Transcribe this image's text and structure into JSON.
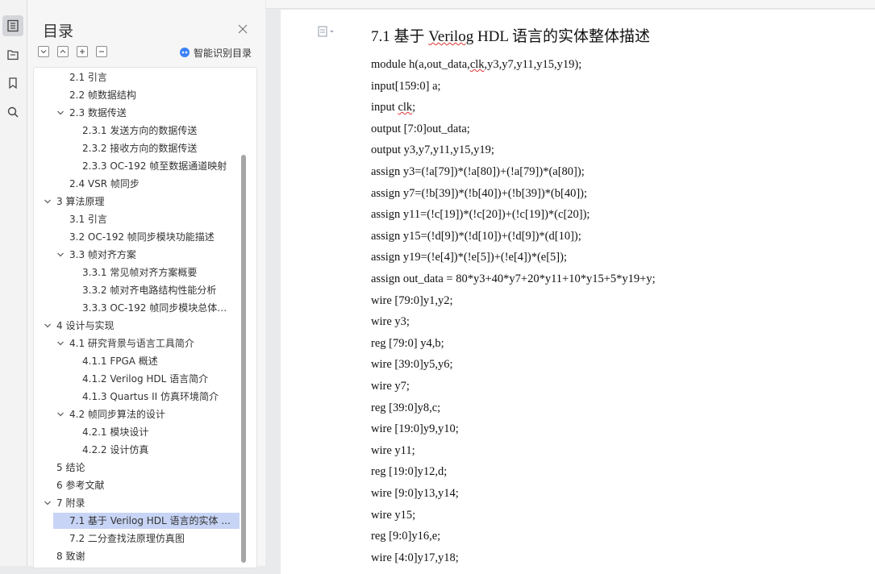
{
  "rail": {
    "icons": [
      "outline-icon",
      "folder-tree-icon",
      "bookmark-icon",
      "search-icon"
    ]
  },
  "panel": {
    "title": "目录",
    "smart_label": "智能识别目录",
    "toolbar": [
      "collapse-all",
      "expand-all",
      "add",
      "remove"
    ],
    "toc": [
      {
        "label": "2.1  引言",
        "level": 2,
        "expandable": false
      },
      {
        "label": "2.2  帧数据结构",
        "level": 2,
        "expandable": false
      },
      {
        "label": "2.3 数据传送",
        "level": 2,
        "expandable": true
      },
      {
        "label": "2.3.1  发送方向的数据传送",
        "level": 3,
        "expandable": false
      },
      {
        "label": "2.3.2  接收方向的数据传送",
        "level": 3,
        "expandable": false
      },
      {
        "label": "2.3.3 OC-192 帧至数据通道映射",
        "level": 3,
        "expandable": false
      },
      {
        "label": "2.4 VSR 帧同步",
        "level": 2,
        "expandable": false
      },
      {
        "label": "3  算法原理",
        "level": 1,
        "expandable": true
      },
      {
        "label": "3.1  引言",
        "level": 2,
        "expandable": false
      },
      {
        "label": "3.2 OC-192 帧同步模块功能描述",
        "level": 2,
        "expandable": false
      },
      {
        "label": "3.3  帧对齐方案",
        "level": 2,
        "expandable": true
      },
      {
        "label": "3.3.1  常见帧对齐方案概要",
        "level": 3,
        "expandable": false
      },
      {
        "label": "3.3.2  帧对齐电路结构性能分析",
        "level": 3,
        "expandable": false
      },
      {
        "label": "3.3.3 OC-192 帧同步模块总体电...",
        "level": 3,
        "expandable": false
      },
      {
        "label": "4  设计与实现",
        "level": 1,
        "expandable": true
      },
      {
        "label": "4.1 研究背景与语言工具简介",
        "level": 2,
        "expandable": true
      },
      {
        "label": "4.1.1 FPGA 概述",
        "level": 3,
        "expandable": false
      },
      {
        "label": "4.1.2 Verilog HDL 语言简介",
        "level": 3,
        "expandable": false
      },
      {
        "label": "4.1.3 Quartus II 仿真环境简介",
        "level": 3,
        "expandable": false
      },
      {
        "label": "4.2  帧同步算法的设计",
        "level": 2,
        "expandable": true
      },
      {
        "label": "4.2.1  模块设计",
        "level": 3,
        "expandable": false
      },
      {
        "label": "4.2.2  设计仿真",
        "level": 3,
        "expandable": false
      },
      {
        "label": "5  结论",
        "level": 1,
        "expandable": false
      },
      {
        "label": "6  参考文献",
        "level": 1,
        "expandable": false
      },
      {
        "label": "7  附录",
        "level": 1,
        "expandable": true
      },
      {
        "label": "7.1  基于 Verilog HDL 语言的实体 ...",
        "level": 2,
        "expandable": false,
        "selected": true
      },
      {
        "label": "7.2  二分查找法原理仿真图",
        "level": 2,
        "expandable": false
      },
      {
        "label": "8  致谢",
        "level": 1,
        "expandable": false
      }
    ]
  },
  "document": {
    "heading": "7.1  基于 Verilog HDL 语言的实体整体描述",
    "lines": [
      "module h(a,out_data,clk,y3,y7,y11,y15,y19);",
      "input[159:0] a;",
      "input clk;",
      "output [7:0]out_data;",
      "output y3,y7,y11,y15,y19;",
      "assign y3=(!a[79])*(!a[80])+(!a[79])*(a[80]);",
      "assign y7=(!b[39])*(!b[40])+(!b[39])*(b[40]);",
      "assign y11=(!c[19])*(!c[20])+(!c[19])*(c[20]);",
      "assign y15=(!d[9])*(!d[10])+(!d[9])*(d[10]);",
      "assign y19=(!e[4])*(!e[5])+(!e[4])*(e[5]);",
      "assign out_data = 80*y3+40*y7+20*y11+10*y15+5*y19+y;",
      "wire [79:0]y1,y2;",
      "wire y3;",
      "reg [79:0] y4,b;",
      "wire [39:0]y5,y6;",
      "wire y7;",
      "reg [39:0]y8,c;",
      "wire [19:0]y9,y10;",
      "wire y11;",
      "reg [19:0]y12,d;",
      "wire [9:0]y13,y14;",
      "wire y15;",
      "reg [9:0]y16,e;",
      "wire [4:0]y17,y18;"
    ]
  }
}
